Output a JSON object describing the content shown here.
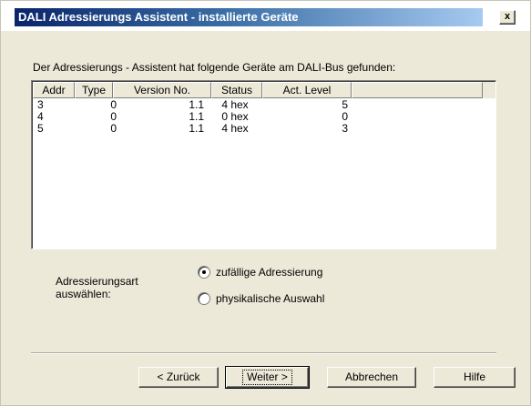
{
  "window": {
    "title": "DALI Adressierungs Assistent - installierte Geräte",
    "close_label": "x"
  },
  "intro_text": "Der Adressierungs - Assistent hat folgende Geräte am DALI-Bus gefunden:",
  "table": {
    "columns": [
      "Addr",
      "Type",
      "Version No.",
      "Status",
      "Act. Level"
    ],
    "rows": [
      [
        "3",
        "0",
        "1.1",
        "4 hex",
        "5"
      ],
      [
        "4",
        "0",
        "1.1",
        "0 hex",
        "0"
      ],
      [
        "5",
        "0",
        "1.1",
        "4 hex",
        "3"
      ]
    ]
  },
  "addressing": {
    "label": "Adressierungsart auswählen:",
    "options": [
      {
        "label": "zufällige Adressierung",
        "selected": true
      },
      {
        "label": "physikalische Auswahl",
        "selected": false
      }
    ]
  },
  "buttons": {
    "back": "< Zurück",
    "next": "Weiter >",
    "cancel": "Abbrechen",
    "help": "Hilfe"
  }
}
